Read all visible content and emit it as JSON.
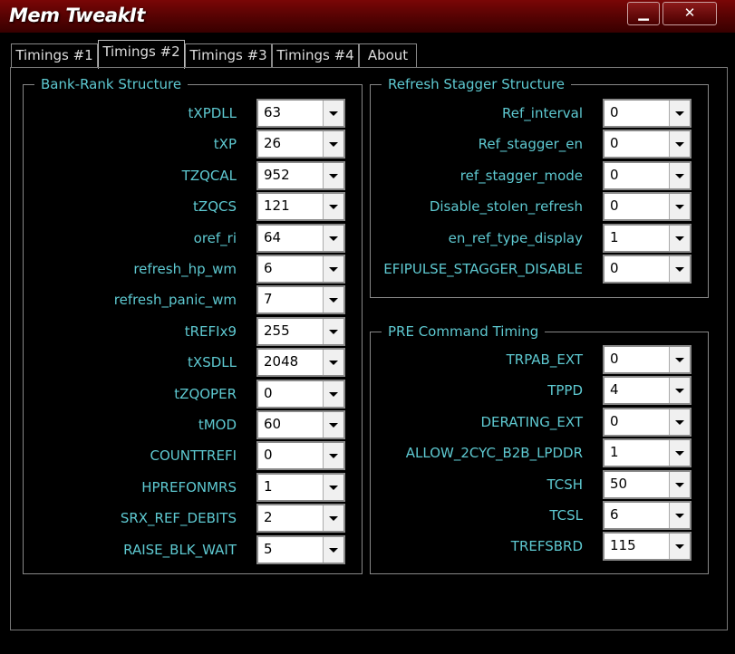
{
  "window": {
    "title": "Mem TweakIt",
    "min_symbol": "▁",
    "close_symbol": "✕"
  },
  "tabs": [
    {
      "label": "Timings #1",
      "active": false
    },
    {
      "label": "Timings #2",
      "active": true
    },
    {
      "label": "Timings #3",
      "active": false
    },
    {
      "label": "Timings #4",
      "active": false
    },
    {
      "label": "About",
      "active": false
    }
  ],
  "bank_rank": {
    "title": "Bank-Rank Structure",
    "rows": [
      {
        "label": "tXPDLL",
        "value": "63"
      },
      {
        "label": "tXP",
        "value": "26"
      },
      {
        "label": "TZQCAL",
        "value": "952"
      },
      {
        "label": "tZQCS",
        "value": "121"
      },
      {
        "label": "oref_ri",
        "value": "64"
      },
      {
        "label": "refresh_hp_wm",
        "value": "6"
      },
      {
        "label": "refresh_panic_wm",
        "value": "7"
      },
      {
        "label": "tREFIx9",
        "value": "255"
      },
      {
        "label": "tXSDLL",
        "value": "2048"
      },
      {
        "label": "tZQOPER",
        "value": "0"
      },
      {
        "label": "tMOD",
        "value": "60"
      },
      {
        "label": "COUNTTREFI",
        "value": "0"
      },
      {
        "label": "HPREFONMRS",
        "value": "1"
      },
      {
        "label": "SRX_REF_DEBITS",
        "value": "2"
      },
      {
        "label": "RAISE_BLK_WAIT",
        "value": "5"
      }
    ]
  },
  "refresh_stagger": {
    "title": "Refresh Stagger Structure",
    "rows": [
      {
        "label": "Ref_interval",
        "value": "0"
      },
      {
        "label": "Ref_stagger_en",
        "value": "0"
      },
      {
        "label": "ref_stagger_mode",
        "value": "0"
      },
      {
        "label": "Disable_stolen_refresh",
        "value": "0"
      },
      {
        "label": "en_ref_type_display",
        "value": "1"
      },
      {
        "label": "EFIPULSE_STAGGER_DISABLE",
        "value": "0"
      }
    ]
  },
  "pre_command": {
    "title": "PRE Command Timing",
    "rows": [
      {
        "label": "TRPAB_EXT",
        "value": "0"
      },
      {
        "label": "TPPD",
        "value": "4"
      },
      {
        "label": "DERATING_EXT",
        "value": "0"
      },
      {
        "label": "ALLOW_2CYC_B2B_LPDDR",
        "value": "1"
      },
      {
        "label": "TCSH",
        "value": "50"
      },
      {
        "label": "TCSL",
        "value": "6"
      },
      {
        "label": "TREFSBRD",
        "value": "115"
      }
    ]
  },
  "colors": {
    "label": "#5ec9d1",
    "titlebar": "#6a0505",
    "background": "#000000"
  }
}
